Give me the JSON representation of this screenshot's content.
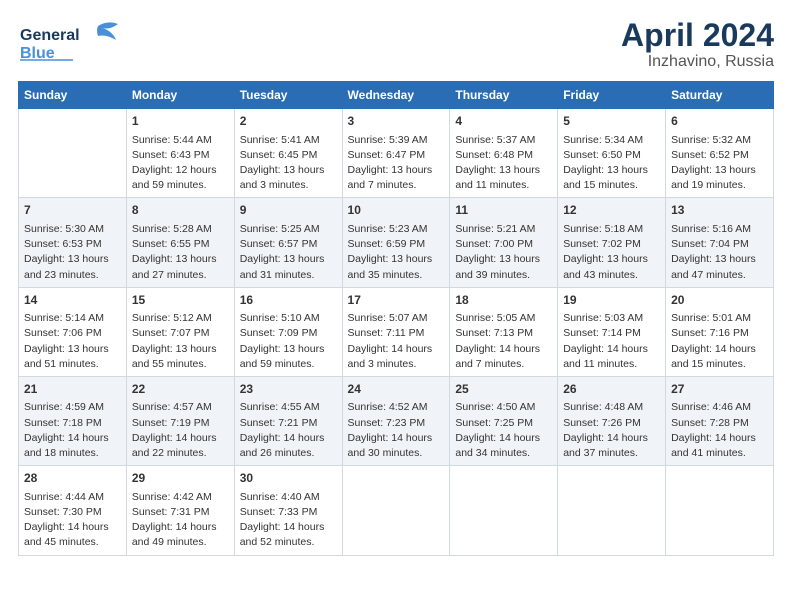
{
  "header": {
    "logo_line1": "General",
    "logo_line2": "Blue",
    "title": "April 2024",
    "subtitle": "Inzhavino, Russia"
  },
  "days_of_week": [
    "Sunday",
    "Monday",
    "Tuesday",
    "Wednesday",
    "Thursday",
    "Friday",
    "Saturday"
  ],
  "weeks": [
    [
      {
        "day": "",
        "content": ""
      },
      {
        "day": "1",
        "content": "Sunrise: 5:44 AM\nSunset: 6:43 PM\nDaylight: 12 hours\nand 59 minutes."
      },
      {
        "day": "2",
        "content": "Sunrise: 5:41 AM\nSunset: 6:45 PM\nDaylight: 13 hours\nand 3 minutes."
      },
      {
        "day": "3",
        "content": "Sunrise: 5:39 AM\nSunset: 6:47 PM\nDaylight: 13 hours\nand 7 minutes."
      },
      {
        "day": "4",
        "content": "Sunrise: 5:37 AM\nSunset: 6:48 PM\nDaylight: 13 hours\nand 11 minutes."
      },
      {
        "day": "5",
        "content": "Sunrise: 5:34 AM\nSunset: 6:50 PM\nDaylight: 13 hours\nand 15 minutes."
      },
      {
        "day": "6",
        "content": "Sunrise: 5:32 AM\nSunset: 6:52 PM\nDaylight: 13 hours\nand 19 minutes."
      }
    ],
    [
      {
        "day": "7",
        "content": "Sunrise: 5:30 AM\nSunset: 6:53 PM\nDaylight: 13 hours\nand 23 minutes."
      },
      {
        "day": "8",
        "content": "Sunrise: 5:28 AM\nSunset: 6:55 PM\nDaylight: 13 hours\nand 27 minutes."
      },
      {
        "day": "9",
        "content": "Sunrise: 5:25 AM\nSunset: 6:57 PM\nDaylight: 13 hours\nand 31 minutes."
      },
      {
        "day": "10",
        "content": "Sunrise: 5:23 AM\nSunset: 6:59 PM\nDaylight: 13 hours\nand 35 minutes."
      },
      {
        "day": "11",
        "content": "Sunrise: 5:21 AM\nSunset: 7:00 PM\nDaylight: 13 hours\nand 39 minutes."
      },
      {
        "day": "12",
        "content": "Sunrise: 5:18 AM\nSunset: 7:02 PM\nDaylight: 13 hours\nand 43 minutes."
      },
      {
        "day": "13",
        "content": "Sunrise: 5:16 AM\nSunset: 7:04 PM\nDaylight: 13 hours\nand 47 minutes."
      }
    ],
    [
      {
        "day": "14",
        "content": "Sunrise: 5:14 AM\nSunset: 7:06 PM\nDaylight: 13 hours\nand 51 minutes."
      },
      {
        "day": "15",
        "content": "Sunrise: 5:12 AM\nSunset: 7:07 PM\nDaylight: 13 hours\nand 55 minutes."
      },
      {
        "day": "16",
        "content": "Sunrise: 5:10 AM\nSunset: 7:09 PM\nDaylight: 13 hours\nand 59 minutes."
      },
      {
        "day": "17",
        "content": "Sunrise: 5:07 AM\nSunset: 7:11 PM\nDaylight: 14 hours\nand 3 minutes."
      },
      {
        "day": "18",
        "content": "Sunrise: 5:05 AM\nSunset: 7:13 PM\nDaylight: 14 hours\nand 7 minutes."
      },
      {
        "day": "19",
        "content": "Sunrise: 5:03 AM\nSunset: 7:14 PM\nDaylight: 14 hours\nand 11 minutes."
      },
      {
        "day": "20",
        "content": "Sunrise: 5:01 AM\nSunset: 7:16 PM\nDaylight: 14 hours\nand 15 minutes."
      }
    ],
    [
      {
        "day": "21",
        "content": "Sunrise: 4:59 AM\nSunset: 7:18 PM\nDaylight: 14 hours\nand 18 minutes."
      },
      {
        "day": "22",
        "content": "Sunrise: 4:57 AM\nSunset: 7:19 PM\nDaylight: 14 hours\nand 22 minutes."
      },
      {
        "day": "23",
        "content": "Sunrise: 4:55 AM\nSunset: 7:21 PM\nDaylight: 14 hours\nand 26 minutes."
      },
      {
        "day": "24",
        "content": "Sunrise: 4:52 AM\nSunset: 7:23 PM\nDaylight: 14 hours\nand 30 minutes."
      },
      {
        "day": "25",
        "content": "Sunrise: 4:50 AM\nSunset: 7:25 PM\nDaylight: 14 hours\nand 34 minutes."
      },
      {
        "day": "26",
        "content": "Sunrise: 4:48 AM\nSunset: 7:26 PM\nDaylight: 14 hours\nand 37 minutes."
      },
      {
        "day": "27",
        "content": "Sunrise: 4:46 AM\nSunset: 7:28 PM\nDaylight: 14 hours\nand 41 minutes."
      }
    ],
    [
      {
        "day": "28",
        "content": "Sunrise: 4:44 AM\nSunset: 7:30 PM\nDaylight: 14 hours\nand 45 minutes."
      },
      {
        "day": "29",
        "content": "Sunrise: 4:42 AM\nSunset: 7:31 PM\nDaylight: 14 hours\nand 49 minutes."
      },
      {
        "day": "30",
        "content": "Sunrise: 4:40 AM\nSunset: 7:33 PM\nDaylight: 14 hours\nand 52 minutes."
      },
      {
        "day": "",
        "content": ""
      },
      {
        "day": "",
        "content": ""
      },
      {
        "day": "",
        "content": ""
      },
      {
        "day": "",
        "content": ""
      }
    ]
  ]
}
